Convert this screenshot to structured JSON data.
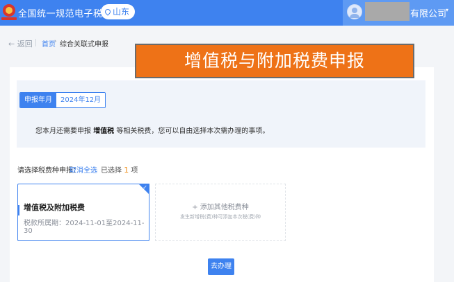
{
  "header": {
    "site_title": "全国统一规范电子税务局",
    "region": "山东",
    "company_suffix": "有限公司",
    "caret": "▾"
  },
  "breadcrumb": {
    "back": "← 返回",
    "home": "首页",
    "separator": "›",
    "current": "综合关联式申报"
  },
  "banner": "增值税与附加税费申报",
  "period": {
    "label": "申报年月",
    "value": "2024年12月"
  },
  "notice": {
    "prefix": "您本月还需要申报",
    "tax": "增值税",
    "suffix": "等相关税费，您可以自由选择本次需办理的事项。"
  },
  "selection": {
    "prompt": "请选择税费种申报：",
    "cancel_all": "取消全选",
    "selected_prefix": "已选择",
    "selected_count": "1",
    "selected_suffix": "项"
  },
  "tax_item": {
    "title": "增值税及附加税费",
    "period": "税款所属期：2024-11-01至2024-11-30",
    "check": "✓"
  },
  "add_other": {
    "title": "+ 添加其他税费种",
    "subtitle": "发生新增税(费)种可添加本次税(费)种"
  },
  "action": {
    "go": "去办理"
  }
}
